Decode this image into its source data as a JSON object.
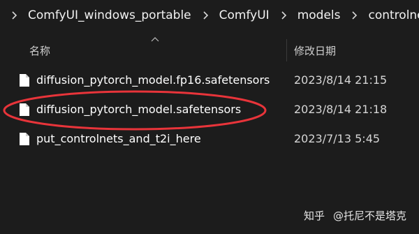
{
  "breadcrumb": {
    "items": [
      {
        "label": "ComfyUI_windows_portable"
      },
      {
        "label": "ComfyUI"
      },
      {
        "label": "models"
      },
      {
        "label": "controlnet"
      }
    ]
  },
  "columns": {
    "name_label": "名称",
    "date_label": "修改日期"
  },
  "files": [
    {
      "name": "diffusion_pytorch_model.fp16.safetensors",
      "modified": "2023/8/14 21:15",
      "icon": "file-icon"
    },
    {
      "name": "diffusion_pytorch_model.safetensors",
      "modified": "2023/8/14 21:18",
      "icon": "file-icon",
      "highlighted": true
    },
    {
      "name": "put_controlnets_and_t2i_here",
      "modified": "2023/7/13 5:45",
      "icon": "file-icon"
    }
  ],
  "annotation": {
    "color": "#e8343a"
  },
  "watermark": {
    "brand": "知乎",
    "author": "@托尼不是塔克"
  },
  "colors": {
    "background": "#1c1c1c",
    "text": "#ffffff"
  }
}
